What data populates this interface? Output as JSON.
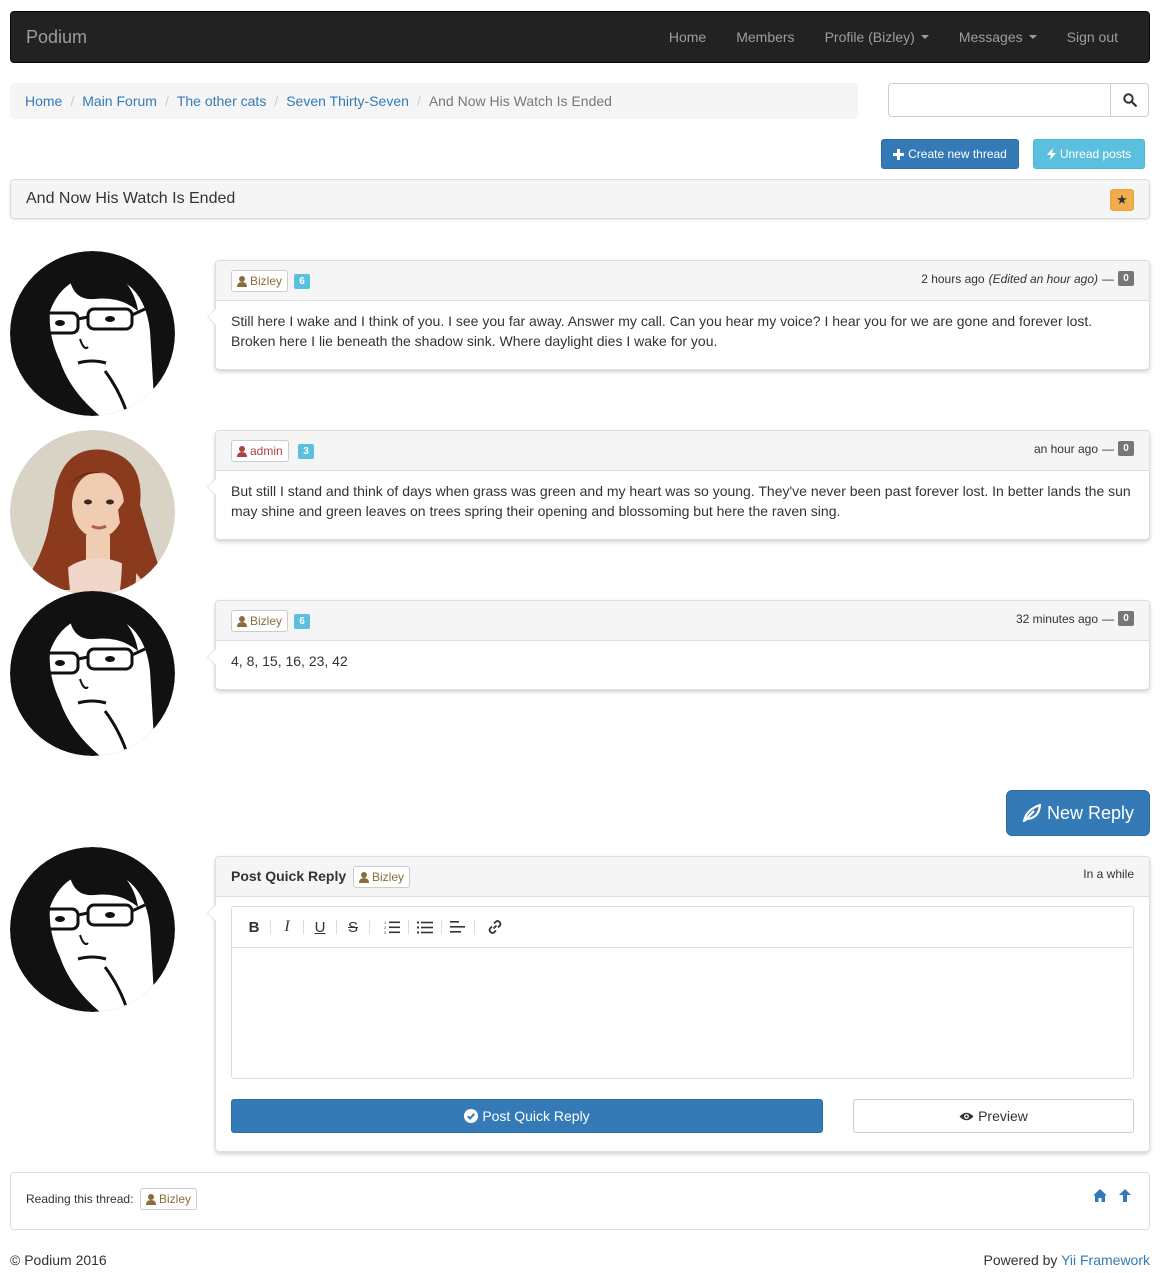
{
  "colors": {
    "navbar_bg": "#222222",
    "primary": "#337ab7",
    "info": "#5bc0de",
    "warning": "#f0ad4e",
    "user_text": "#8a6d3b",
    "admin_text": "#a94442"
  },
  "navbar": {
    "brand": "Podium",
    "items": [
      {
        "label": "Home"
      },
      {
        "label": "Members"
      },
      {
        "label": "Profile (Bizley)",
        "dropdown": true
      },
      {
        "label": "Messages",
        "dropdown": true
      },
      {
        "label": "Sign out"
      }
    ]
  },
  "breadcrumb": {
    "items": [
      "Home",
      "Main Forum",
      "The other cats",
      "Seven Thirty-Seven"
    ],
    "active": "And Now His Watch Is Ended",
    "separator": "/"
  },
  "search": {
    "value": "",
    "placeholder": "",
    "icon": "search-icon"
  },
  "actions": {
    "create_label": "Create new thread",
    "create_icon": "plus-icon",
    "unread_label": "Unread posts",
    "unread_icon": "bolt-icon"
  },
  "thread": {
    "title": "And Now His Watch Is Ended",
    "star_icon": "star-icon"
  },
  "posts": [
    {
      "author": "Bizley",
      "role": "user",
      "post_count": "6",
      "time": "2 hours ago",
      "edited": "(Edited an hour ago)",
      "dash": "—",
      "likes": "0",
      "avatar": "sketch-avatar",
      "body": "Still here I wake and I think of you. I see you far away. Answer my call. Can you hear my voice? I hear you for we are gone and forever lost. Broken here I lie beneath the shadow sink. Where daylight dies I wake for you."
    },
    {
      "author": "admin",
      "role": "admin",
      "post_count": "3",
      "time": "an hour ago",
      "edited": "",
      "dash": "—",
      "likes": "0",
      "avatar": "photo-avatar",
      "body": "But still I stand and think of days when grass was green and my heart was so young. They've never been past forever lost. In better lands the sun may shine and green leaves on trees spring their opening and blossoming but here the raven sing."
    },
    {
      "author": "Bizley",
      "role": "user",
      "post_count": "6",
      "time": "32 minutes ago",
      "edited": "",
      "dash": "—",
      "likes": "0",
      "avatar": "sketch-avatar",
      "body": "4, 8, 15, 16, 23, 42"
    }
  ],
  "new_reply": {
    "label": "New Reply",
    "icon": "leaf-icon"
  },
  "quick_reply": {
    "title": "Post Quick Reply",
    "author": "Bizley",
    "meta": "In a while",
    "editor_value": "",
    "toolbar": [
      "bold",
      "italic",
      "underline",
      "strikethrough",
      "ordered-list",
      "bullet-list",
      "align-left",
      "link"
    ],
    "toolbar_glyphs": {
      "bold": "B",
      "italic": "I",
      "underline": "U",
      "strikethrough": "S"
    },
    "post_label": "Post Quick Reply",
    "post_icon": "check-circle-icon",
    "preview_label": "Preview",
    "preview_icon": "eye-icon"
  },
  "reading": {
    "label": "Reading this thread:",
    "user": "Bizley",
    "icons": [
      "home-icon",
      "arrow-up-icon"
    ]
  },
  "footer": {
    "copyright": "© Podium 2016",
    "powered_prefix": "Powered by ",
    "powered_link": "Yii Framework"
  }
}
